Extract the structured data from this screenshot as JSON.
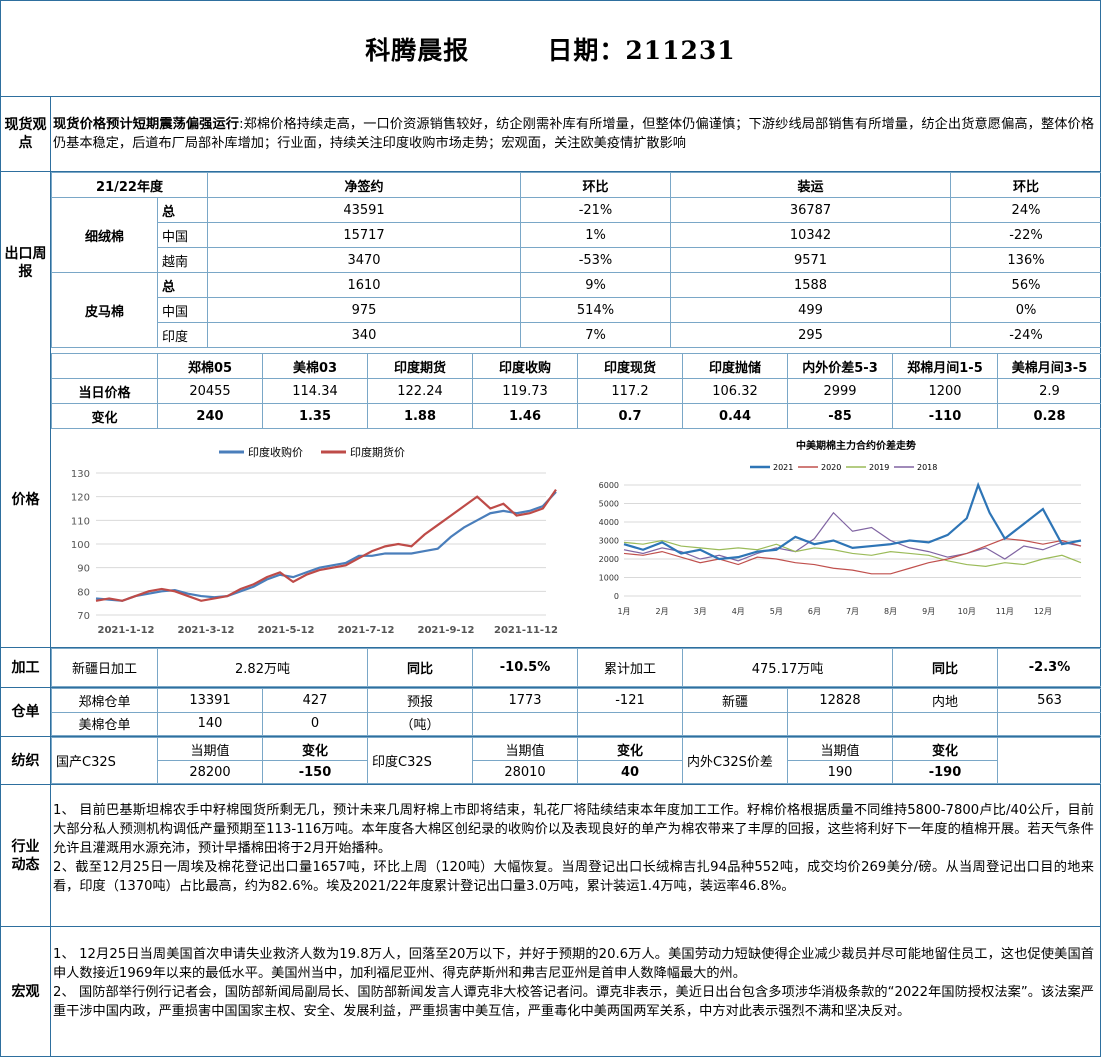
{
  "header": {
    "title": "科腾晨报",
    "date_label": "日期：211231"
  },
  "spot": {
    "label": "现货观点",
    "headline": "现货价格预计短期震荡偏强运行",
    "body": ":郑棉价格持续走高，一口价资源销售较好，纺企刚需补库有所增量，但整体仍偏谨慎；下游纱线局部销售有所增量，纺企出货意愿偏高，整体价格仍基本稳定，后道布厂局部补库增加；行业面，持续关注印度收购市场走势；宏观面，关注欧美疫情扩散影响"
  },
  "export": {
    "label": "出口周报",
    "headers": [
      "21/22年度",
      "净签约",
      "环比",
      "装运",
      "环比"
    ],
    "groups": [
      {
        "name": "细绒棉",
        "rows": [
          [
            "总",
            "43591",
            "-21%",
            "36787",
            "24%"
          ],
          [
            "中国",
            "15717",
            "1%",
            "10342",
            "-22%"
          ],
          [
            "越南",
            "3470",
            "-53%",
            "9571",
            "136%"
          ]
        ]
      },
      {
        "name": "皮马棉",
        "rows": [
          [
            "总",
            "1610",
            "9%",
            "1588",
            "56%"
          ],
          [
            "中国",
            "975",
            "514%",
            "499",
            "0%"
          ],
          [
            "印度",
            "340",
            "7%",
            "295",
            "-24%"
          ]
        ]
      }
    ]
  },
  "price": {
    "label": "价格",
    "headers": [
      "郑棉05",
      "美棉03",
      "印度期货",
      "印度收购",
      "印度现货",
      "印度抛储",
      "内外价差5-3",
      "郑棉月间1-5",
      "美棉月间3-5"
    ],
    "row1_label": "当日价格",
    "row1": [
      "20455",
      "114.34",
      "122.24",
      "119.73",
      "117.2",
      "106.32",
      "2999",
      "1200",
      "2.9"
    ],
    "row2_label": "变化",
    "row2": [
      "240",
      "1.35",
      "1.88",
      "1.46",
      "0.7",
      "0.44",
      "-85",
      "-110",
      "0.28"
    ]
  },
  "chart_data": [
    {
      "type": "line",
      "title": "",
      "legend": [
        "印度收购价",
        "印度期货价"
      ],
      "colors": [
        "#4a7ebb",
        "#be4b48"
      ],
      "x_ticks": [
        "2021-1-12",
        "2021-3-12",
        "2021-5-12",
        "2021-7-12",
        "2021-9-12",
        "2021-11-12"
      ],
      "ylim": [
        70,
        130
      ],
      "y_ticks": [
        "70",
        "80",
        "90",
        "100",
        "110",
        "120",
        "130"
      ],
      "series": [
        {
          "name": "印度收购价",
          "x": [
            0,
            10,
            20,
            30,
            40,
            50,
            60,
            70,
            80,
            90,
            100,
            110,
            120,
            130,
            140,
            150,
            160,
            170,
            180,
            190,
            200,
            210,
            220,
            230,
            240,
            250,
            260,
            270,
            280,
            290,
            300,
            310,
            320,
            330,
            340,
            350
          ],
          "values": [
            77,
            76.5,
            76,
            78,
            79,
            80,
            80.5,
            79,
            78,
            77.5,
            78,
            80,
            82,
            85,
            87,
            86,
            88,
            90,
            91,
            92,
            95,
            95,
            96,
            96,
            96,
            97,
            98,
            103,
            107,
            110,
            113,
            114,
            113,
            114,
            116,
            122
          ]
        },
        {
          "name": "印度期货价",
          "x": [
            0,
            10,
            20,
            30,
            40,
            50,
            60,
            70,
            80,
            90,
            100,
            110,
            120,
            130,
            140,
            150,
            160,
            170,
            180,
            190,
            200,
            210,
            220,
            230,
            240,
            250,
            260,
            270,
            280,
            290,
            300,
            310,
            320,
            330,
            340,
            350
          ],
          "values": [
            76,
            77,
            76,
            78,
            80,
            81,
            80,
            78,
            76,
            77,
            78,
            81,
            83,
            86,
            88,
            84,
            87,
            89,
            90,
            91,
            94,
            97,
            99,
            100,
            99,
            104,
            108,
            112,
            116,
            120,
            115,
            117,
            112,
            113,
            115,
            123
          ]
        }
      ]
    },
    {
      "type": "line",
      "title": "中美期棉主力合约价差走势",
      "legend": [
        "2021",
        "2020",
        "2019",
        "2018"
      ],
      "colors": [
        "#2e75b6",
        "#c0504d",
        "#9bbb59",
        "#8064a2"
      ],
      "ylim": [
        0,
        6000
      ],
      "y_ticks": [
        "0",
        "1000",
        "2000",
        "3000",
        "4000",
        "5000",
        "6000"
      ],
      "x_ticks": [
        "1月",
        "2月",
        "3月",
        "4月",
        "5月",
        "6月",
        "7月",
        "8月",
        "9月",
        "10月",
        "11月",
        "12月"
      ],
      "series": [
        {
          "name": "2021",
          "x": [
            0,
            0.5,
            1,
            1.5,
            2,
            2.5,
            3,
            3.5,
            4,
            4.5,
            5,
            5.5,
            6,
            6.5,
            7,
            7.5,
            8,
            8.5,
            9,
            9.3,
            9.6,
            10,
            10.5,
            11,
            11.5,
            12
          ],
          "values": [
            2800,
            2500,
            2900,
            2300,
            2500,
            2000,
            2100,
            2400,
            2500,
            3200,
            2800,
            3000,
            2600,
            2700,
            2800,
            3000,
            2900,
            3300,
            4200,
            6000,
            4500,
            3100,
            3900,
            4700,
            2800,
            3000
          ]
        },
        {
          "name": "2020",
          "x": [
            0,
            0.5,
            1,
            1.5,
            2,
            2.5,
            3,
            3.5,
            4,
            4.5,
            5,
            5.5,
            6,
            6.5,
            7,
            7.5,
            8,
            8.5,
            9,
            9.5,
            10,
            10.5,
            11,
            11.5,
            12
          ],
          "values": [
            2300,
            2200,
            2400,
            2100,
            1800,
            2000,
            1700,
            2100,
            2000,
            1800,
            1700,
            1500,
            1400,
            1200,
            1200,
            1500,
            1800,
            2000,
            2300,
            2700,
            3100,
            3000,
            2800,
            3000,
            2700
          ]
        },
        {
          "name": "2019",
          "x": [
            0,
            0.5,
            1,
            1.5,
            2,
            2.5,
            3,
            3.5,
            4,
            4.5,
            5,
            5.5,
            6,
            6.5,
            7,
            7.5,
            8,
            8.5,
            9,
            9.5,
            10,
            10.5,
            11,
            11.5,
            12
          ],
          "values": [
            2900,
            2800,
            3000,
            2700,
            2600,
            2500,
            2600,
            2500,
            2800,
            2400,
            2600,
            2500,
            2300,
            2200,
            2400,
            2300,
            2200,
            1900,
            1700,
            1600,
            1800,
            1700,
            2000,
            2200,
            1800
          ]
        },
        {
          "name": "2018",
          "x": [
            0,
            0.5,
            1,
            1.5,
            2,
            2.5,
            3,
            3.5,
            4,
            4.5,
            5,
            5.5,
            6,
            6.5,
            7,
            7.5,
            8,
            8.5,
            9,
            9.5,
            10,
            10.5,
            11,
            11.5,
            12
          ],
          "values": [
            2500,
            2300,
            2600,
            2400,
            2000,
            2200,
            1900,
            2300,
            2600,
            2400,
            3100,
            4500,
            3500,
            3700,
            3000,
            2600,
            2400,
            2100,
            2300,
            2600,
            2000,
            2700,
            2500,
            2900,
            2700
          ]
        }
      ]
    }
  ],
  "processing": {
    "label": "加工",
    "c1": "新疆日加工",
    "c2": "2.82万吨",
    "c3": "同比",
    "c4": "-10.5%",
    "c5": "累计加工",
    "c6": "475.17万吨",
    "c7": "同比",
    "c8": "-2.3%"
  },
  "warehouse": {
    "label": "仓单",
    "r1": [
      "郑棉仓单",
      "13391",
      "427",
      "预报",
      "1773",
      "-121",
      "新疆",
      "12828",
      "内地",
      "563"
    ],
    "r2": [
      "美棉仓单",
      "140",
      "0",
      "（吨）"
    ]
  },
  "textile": {
    "label": "纺织",
    "g1": {
      "name": "国产C32S",
      "h1": "当期值",
      "h2": "变化",
      "v1": "28200",
      "v2": "-150"
    },
    "g2": {
      "name": "印度C32S",
      "h1": "当期值",
      "h2": "变化",
      "v1": "28010",
      "v2": "40"
    },
    "g3": {
      "name": "内外C32S价差",
      "h1": "当期值",
      "h2": "变化",
      "v1": "190",
      "v2": "-190"
    }
  },
  "industry": {
    "label": "行业动态",
    "p1": "1、 目前巴基斯坦棉农手中籽棉囤货所剩无几，预计未来几周籽棉上市即将结束，轧花厂将陆续结束本年度加工工作。籽棉价格根据质量不同维持5800-7800卢比/40公斤，目前大部分私人预测机构调低产量预期至113-116万吨。本年度各大棉区创纪录的收购价以及表现良好的单产为棉农带来了丰厚的回报，这些将利好下一年度的植棉开展。若天气条件允许且灌溉用水源充沛，预计早播棉田将于2月开始播种。",
    "p2": "2、截至12月25日一周埃及棉花登记出口量1657吨，环比上周（120吨）大幅恢复。当周登记出口长绒棉吉扎94品种552吨，成交均价269美分/磅。从当周登记出口目的地来看，印度（1370吨）占比最高，约为82.6%。埃及2021/22年度累计登记出口量3.0万吨，累计装运1.4万吨，装运率46.8%。"
  },
  "macro": {
    "label": "宏观",
    "p1": "1、 12月25日当周美国首次申请失业救济人数为19.8万人，回落至20万以下，并好于预期的20.6万人。美国劳动力短缺使得企业减少裁员并尽可能地留住员工，这也促使美国首申人数接近1969年以来的最低水平。美国州当中，加利福尼亚州、得克萨斯州和弗吉尼亚州是首申人数降幅最大的州。",
    "p2": "2、 国防部举行例行记者会，国防部新闻局副局长、国防部新闻发言人谭克非大校答记者问。谭克非表示，美近日出台包含多项涉华消极条款的“2022年国防授权法案”。该法案严重干涉中国内政，严重损害中国国家主权、安全、发展利益，严重损害中美互信，严重毒化中美两国两军关系，中方对此表示强烈不满和坚决反对。"
  }
}
